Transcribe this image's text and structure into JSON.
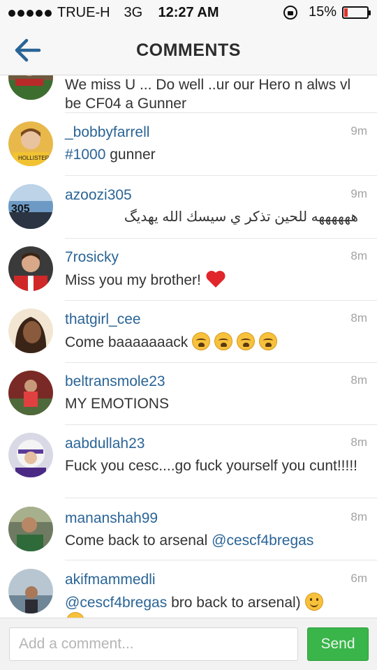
{
  "status_bar": {
    "carrier": "TRUE-H",
    "network": "3G",
    "time": "12:27 AM",
    "battery_percent": "15%",
    "battery_level": 0.15,
    "battery_color": "#e0322b"
  },
  "nav": {
    "title": "COMMENTS",
    "back_icon": "arrow-left-icon"
  },
  "comments": [
    {
      "username": "",
      "text": "We miss U ... Do well ..ur our Hero n alws vl be CF04 a Gunner",
      "time": ""
    },
    {
      "username": "_bobbyfarrell",
      "text": "gunner",
      "hashtag": "#1000",
      "time": "9m"
    },
    {
      "username": "azoozi305",
      "text": "ههههههه للحين تذكر ي سيسك الله يهديگ",
      "time": "9m"
    },
    {
      "username": "7rosicky",
      "text": "Miss you my brother!",
      "time": "8m",
      "emoji": "red-heart"
    },
    {
      "username": "thatgirl_cee",
      "text": "Come baaaaaaack",
      "time": "8m",
      "emoji": "weary-face x4"
    },
    {
      "username": "beltransmole23",
      "text": "MY EMOTIONS",
      "time": "8m"
    },
    {
      "username": "aabdullah23",
      "text": "Fuck you cesc....go fuck yourself you cunt!!!!!",
      "time": "8m"
    },
    {
      "username": "mananshah99",
      "text": "Come back to arsenal",
      "mention": "@cescf4bregas",
      "time": "8m"
    },
    {
      "username": "akifmammedli",
      "text": "bro back to arsenal)",
      "mention": "@cescf4bregas",
      "time": "6m",
      "emoji": "smiling-face"
    }
  ],
  "input": {
    "placeholder": "Add a comment...",
    "value": "",
    "send_label": "Send"
  },
  "colors": {
    "link": "#2a6496",
    "send_button": "#3ab54a",
    "back_arrow": "#2a6496"
  }
}
